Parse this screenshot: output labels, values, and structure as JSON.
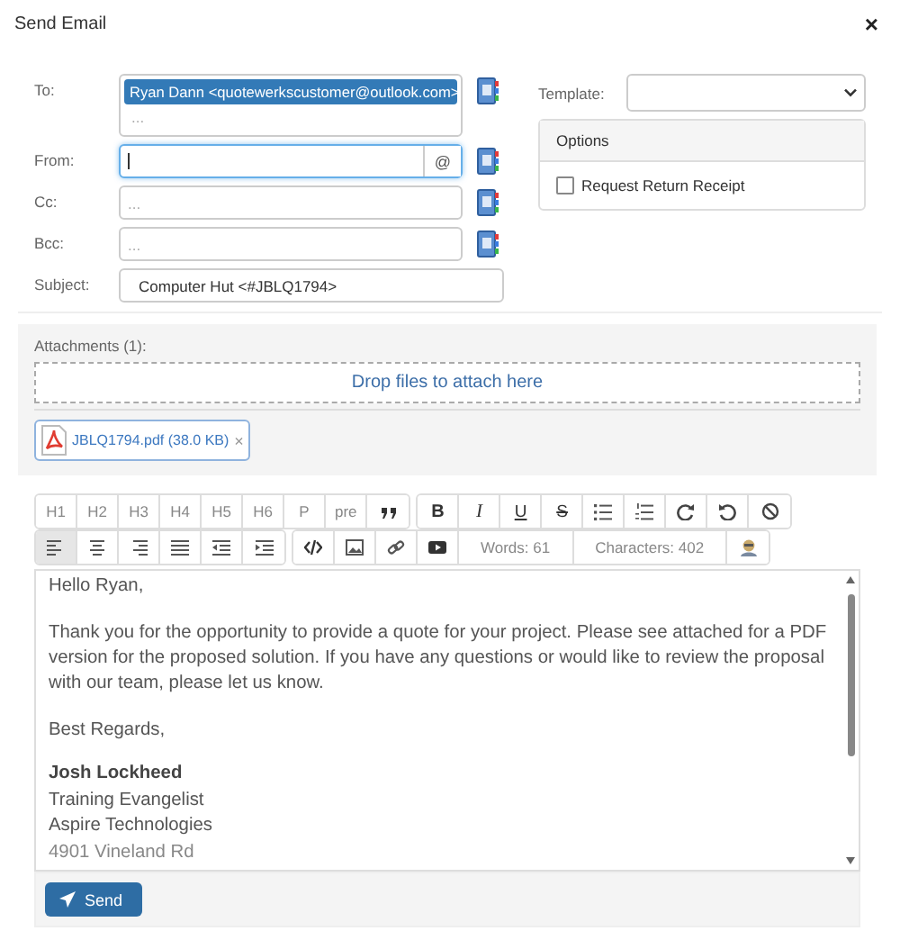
{
  "window": {
    "title": "Send Email",
    "close": "×"
  },
  "fields": [
    {
      "kind": "recipients",
      "label": "To:",
      "chips": [
        {
          "text": "Ryan Dann <quotewerkscustomer@outlook.com>",
          "selected": true
        }
      ],
      "placeholder": "...",
      "focused": false
    },
    {
      "kind": "address",
      "label": "From:",
      "addon": "@",
      "focused": true
    },
    {
      "kind": "address",
      "label": "Cc:",
      "placeholder": "...",
      "focused": false
    },
    {
      "kind": "address",
      "label": "Bcc:",
      "placeholder": "...",
      "focused": false
    },
    {
      "kind": "text",
      "label": "Subject:",
      "value": "Computer Hut <#JBLQ1794>",
      "focused": false
    }
  ],
  "template": {
    "label": "Template:"
  },
  "options": {
    "title": "Options",
    "items": [
      {
        "label": "Request Return Receipt",
        "checked": false
      }
    ]
  },
  "attachments": {
    "label": "Attachments (1):",
    "dropzone": "Drop files to attach here",
    "files": [
      {
        "name": "JBLQ1794.pdf (38.0 KB)",
        "remove": "×"
      }
    ]
  },
  "toolbar": {
    "rows": [
      {
        "groups": [
          [
            {
              "kind": "text",
              "label": "H1",
              "selected": false
            },
            {
              "kind": "text",
              "label": "H2",
              "selected": false
            },
            {
              "kind": "text",
              "label": "H3",
              "selected": false
            },
            {
              "kind": "text",
              "label": "H4",
              "selected": false
            },
            {
              "kind": "text",
              "label": "H5",
              "selected": false
            },
            {
              "kind": "text",
              "label": "H6",
              "selected": false
            },
            {
              "kind": "text",
              "label": "P",
              "selected": false
            },
            {
              "kind": "text",
              "label": "pre",
              "selected": false
            },
            {
              "kind": "quote",
              "selected": false
            }
          ],
          [
            {
              "kind": "bold",
              "label": "B",
              "selected": false
            },
            {
              "kind": "italic",
              "label": "I",
              "selected": false
            },
            {
              "kind": "underline",
              "label": "U",
              "selected": false
            },
            {
              "kind": "strike",
              "label": "S",
              "selected": false
            },
            {
              "kind": "bullets",
              "selected": false
            },
            {
              "kind": "numbers",
              "selected": false
            },
            {
              "kind": "redo",
              "selected": false
            },
            {
              "kind": "undo",
              "selected": false
            },
            {
              "kind": "clear",
              "selected": false
            }
          ]
        ]
      },
      {
        "groups": [
          [
            {
              "kind": "align-left",
              "selected": true
            },
            {
              "kind": "align-center",
              "selected": false
            },
            {
              "kind": "align-right",
              "selected": false
            },
            {
              "kind": "justify",
              "selected": false
            },
            {
              "kind": "outdent",
              "selected": false
            },
            {
              "kind": "indent",
              "selected": false
            }
          ],
          [
            {
              "kind": "code",
              "selected": false
            },
            {
              "kind": "image",
              "selected": false
            },
            {
              "kind": "link",
              "selected": false
            },
            {
              "kind": "video",
              "selected": false
            },
            {
              "kind": "counter",
              "label": "Words: 61",
              "selected": false
            },
            {
              "kind": "counter",
              "label": "Characters: 402",
              "selected": false
            },
            {
              "kind": "avatar",
              "selected": false
            }
          ]
        ]
      }
    ]
  },
  "editor": {
    "blocks": [
      {
        "kind": "paragraph",
        "text": "Hello Ryan,"
      },
      {
        "kind": "paragraph",
        "text": "Thank you for the opportunity to provide a quote for your project. Please see attached for a PDF version for the proposed solution. If you have any questions or would like to review the proposal with our team, please let us know."
      },
      {
        "kind": "paragraph",
        "text": "Best Regards,"
      },
      {
        "kind": "signature",
        "lines": [
          {
            "text": "Josh Lockheed",
            "kind": "name"
          },
          {
            "text": "Training Evangelist",
            "kind": "line"
          },
          {
            "text": "Aspire Technologies",
            "kind": "line"
          },
          {
            "text": "4901 Vineland Rd",
            "kind": "address"
          }
        ]
      }
    ]
  },
  "send": {
    "label": "Send"
  }
}
